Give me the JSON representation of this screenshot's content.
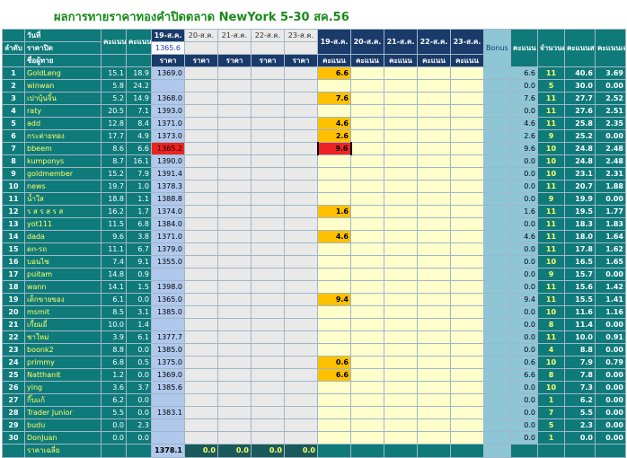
{
  "title": "ผลการทายราคาทองคำปิดตลาด NewYork 5-30 สค.56",
  "header": {
    "rank": "ลำดับ",
    "date_label": "วันที่",
    "close_label": "ราคาปิด",
    "player_label": "ชื่อผู้ทาย",
    "week1": "คะแนน week1",
    "week2": "คะแนน week2",
    "price_dates": [
      "19-ส.ค.",
      "20-ส.ค.",
      "21-ส.ค.",
      "22-ส.ค.",
      "23-ส.ค."
    ],
    "price_sub": "ราคา",
    "reference_price": "1365.6",
    "score_dates": [
      "19-ส.ค.",
      "20-ส.ค.",
      "21-ส.ค.",
      "22-ส.ค.",
      "23-ส.ค."
    ],
    "score_sub": "คะแนน",
    "bonus": "Bonus week3",
    "week3": "คะแนน week3",
    "count": "จำนวนครั้ง",
    "total": "คะแนนสะสม",
    "avg": "คะแนนเฉลี่ย"
  },
  "rows": [
    {
      "n": "1",
      "name": "GoldLeng",
      "w1": "15.1",
      "w2": "18.9",
      "price": "1369.0",
      "score": "6.6",
      "w3": "6.6",
      "cnt": "11",
      "tot": "40.6",
      "avg": "3.69"
    },
    {
      "n": "2",
      "name": "winwan",
      "w1": "5.8",
      "w2": "24.2",
      "price": "",
      "score": "",
      "w3": "0.0",
      "cnt": "5",
      "tot": "30.0",
      "avg": "0.00"
    },
    {
      "n": "3",
      "name": "เปาบุ้นจิ้น",
      "w1": "5.2",
      "w2": "14.9",
      "price": "1368.0",
      "score": "7.6",
      "w3": "7.6",
      "cnt": "11",
      "tot": "27.7",
      "avg": "2.52"
    },
    {
      "n": "4",
      "name": "raty",
      "w1": "20.5",
      "w2": "7.1",
      "price": "1393.0",
      "score": "",
      "w3": "0.0",
      "cnt": "11",
      "tot": "27.6",
      "avg": "2.51"
    },
    {
      "n": "5",
      "name": "add",
      "w1": "12.8",
      "w2": "8.4",
      "price": "1371.0",
      "score": "4.6",
      "w3": "4.6",
      "cnt": "11",
      "tot": "25.8",
      "avg": "2.35"
    },
    {
      "n": "6",
      "name": "กระต่ายทอง",
      "w1": "17.7",
      "w2": "4.9",
      "price": "1373.0",
      "score": "2.6",
      "w3": "2.6",
      "cnt": "9",
      "tot": "25.2",
      "avg": "0.00"
    },
    {
      "n": "7",
      "name": "bbeem",
      "w1": "8.6",
      "w2": "6.6",
      "price": "1365.2",
      "score": "9.6",
      "w3": "9.6",
      "cnt": "10",
      "tot": "24.8",
      "avg": "2.48"
    },
    {
      "n": "8",
      "name": "kumponys",
      "w1": "8.7",
      "w2": "16.1",
      "price": "1390.0",
      "score": "",
      "w3": "0.0",
      "cnt": "10",
      "tot": "24.8",
      "avg": "2.48"
    },
    {
      "n": "9",
      "name": "goldmember",
      "w1": "15.2",
      "w2": "7.9",
      "price": "1391.4",
      "score": "",
      "w3": "0.0",
      "cnt": "10",
      "tot": "23.1",
      "avg": "2.31"
    },
    {
      "n": "10",
      "name": "news",
      "w1": "19.7",
      "w2": "1.0",
      "price": "1378.3",
      "score": "",
      "w3": "0.0",
      "cnt": "11",
      "tot": "20.7",
      "avg": "1.88"
    },
    {
      "n": "11",
      "name": "น้ำใส",
      "w1": "18.8",
      "w2": "1.1",
      "price": "1388.8",
      "score": "",
      "w3": "0.0",
      "cnt": "9",
      "tot": "19.9",
      "avg": "0.00"
    },
    {
      "n": "12",
      "name": "ร ส ร ส ร ส",
      "w1": "16.2",
      "w2": "1.7",
      "price": "1374.0",
      "score": "1.6",
      "w3": "1.6",
      "cnt": "11",
      "tot": "19.5",
      "avg": "1.77"
    },
    {
      "n": "13",
      "name": "yot111",
      "w1": "11.5",
      "w2": "6.8",
      "price": "1384.0",
      "score": "",
      "w3": "0.0",
      "cnt": "11",
      "tot": "18.3",
      "avg": "1.83"
    },
    {
      "n": "14",
      "name": "dada",
      "w1": "9.6",
      "w2": "3.8",
      "price": "1371.0",
      "score": "4.6",
      "w3": "4.6",
      "cnt": "11",
      "tot": "18.0",
      "avg": "1.64"
    },
    {
      "n": "15",
      "name": "ตก-รถ",
      "w1": "11.1",
      "w2": "6.7",
      "price": "1379.0",
      "score": "",
      "w3": "0.0",
      "cnt": "11",
      "tot": "17.8",
      "avg": "1.62"
    },
    {
      "n": "16",
      "name": "บอนไซ",
      "w1": "7.4",
      "w2": "9.1",
      "price": "1355.0",
      "score": "",
      "w3": "0.0",
      "cnt": "10",
      "tot": "16.5",
      "avg": "1.65"
    },
    {
      "n": "17",
      "name": "puitam",
      "w1": "14.8",
      "w2": "0.9",
      "price": "",
      "score": "",
      "w3": "0.0",
      "cnt": "9",
      "tot": "15.7",
      "avg": "0.00"
    },
    {
      "n": "18",
      "name": "wann",
      "w1": "14.1",
      "w2": "1.5",
      "price": "1398.0",
      "score": "",
      "w3": "0.0",
      "cnt": "11",
      "tot": "15.6",
      "avg": "1.42"
    },
    {
      "n": "19",
      "name": "เด็กขายของ",
      "w1": "6.1",
      "w2": "0.0",
      "price": "1365.0",
      "score": "9.4",
      "w3": "9.4",
      "cnt": "11",
      "tot": "15.5",
      "avg": "1.41"
    },
    {
      "n": "20",
      "name": "msmit",
      "w1": "8.5",
      "w2": "3.1",
      "price": "1385.0",
      "score": "",
      "w3": "0.0",
      "cnt": "10",
      "tot": "11.6",
      "avg": "1.16"
    },
    {
      "n": "21",
      "name": "เกี้ยมอี๋",
      "w1": "10.0",
      "w2": "1.4",
      "price": "",
      "score": "",
      "w3": "0.0",
      "cnt": "8",
      "tot": "11.4",
      "avg": "0.00"
    },
    {
      "n": "22",
      "name": "ชาใหม่",
      "w1": "3.9",
      "w2": "6.1",
      "price": "1377.7",
      "score": "",
      "w3": "0.0",
      "cnt": "11",
      "tot": "10.0",
      "avg": "0.91"
    },
    {
      "n": "23",
      "name": "boonk2",
      "w1": "8.8",
      "w2": "0.0",
      "price": "1385.0",
      "score": "",
      "w3": "0.0",
      "cnt": "4",
      "tot": "8.8",
      "avg": "0.00"
    },
    {
      "n": "24",
      "name": "primmy",
      "w1": "6.8",
      "w2": "0.5",
      "price": "1375.0",
      "score": "0.6",
      "w3": "0.6",
      "cnt": "10",
      "tot": "7.9",
      "avg": "0.79"
    },
    {
      "n": "25",
      "name": "Natthanit",
      "w1": "1.2",
      "w2": "0.0",
      "price": "1369.0",
      "score": "6.6",
      "w3": "6.6",
      "cnt": "8",
      "tot": "7.8",
      "avg": "0.00"
    },
    {
      "n": "26",
      "name": "ying",
      "w1": "3.6",
      "w2": "3.7",
      "price": "1385.6",
      "score": "",
      "w3": "0.0",
      "cnt": "10",
      "tot": "7.3",
      "avg": "0.00"
    },
    {
      "n": "27",
      "name": "กิ๊บแก้",
      "w1": "6.2",
      "w2": "0.0",
      "price": "",
      "score": "",
      "w3": "0.0",
      "cnt": "1",
      "tot": "6.2",
      "avg": "0.00"
    },
    {
      "n": "28",
      "name": "Trader Junior",
      "w1": "5.5",
      "w2": "0.0",
      "price": "1383.1",
      "score": "",
      "w3": "0.0",
      "cnt": "7",
      "tot": "5.5",
      "avg": "0.00"
    },
    {
      "n": "29",
      "name": "budu",
      "w1": "0.0",
      "w2": "2.3",
      "price": "",
      "score": "",
      "w3": "0.0",
      "cnt": "5",
      "tot": "2.3",
      "avg": "0.00"
    },
    {
      "n": "30",
      "name": "DonJuan",
      "w1": "0.0",
      "w2": "0.0",
      "price": "",
      "score": "",
      "w3": "0.0",
      "cnt": "1",
      "tot": "0.0",
      "avg": "0.00"
    }
  ],
  "footer": {
    "label": "ราคาเฉลี่ย",
    "avg_price": "1378.1",
    "others": [
      "0.0",
      "0.0",
      "0.0",
      "0.0"
    ]
  },
  "colors": {
    "teal": "#0f7a7a",
    "price_blue": "#b0c8ec",
    "score_yellow": "#ffffcc",
    "score_orange": "#ffc000",
    "red": "#ee2222",
    "bonus_blue": "#8ec6d6",
    "title_green": "#1a8a1a"
  }
}
